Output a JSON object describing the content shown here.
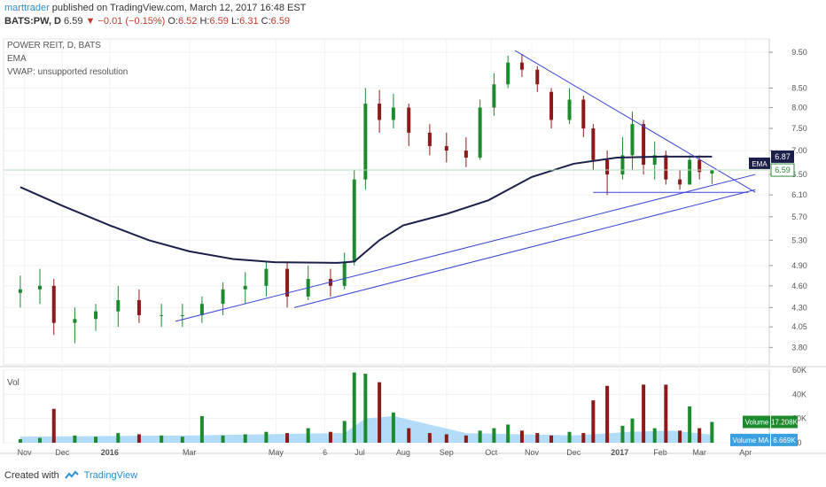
{
  "header": {
    "author": "marttrader",
    "published_text": " published on TradingView.com, March 12, 2017 16:48 EST",
    "symbol": "BATS:PW, D",
    "last": "6.59",
    "change": "−0.01 (−0.15%)",
    "open_label": "O:",
    "open": "6.52",
    "high_label": "H:",
    "high": "6.59",
    "low_label": "L:",
    "low": "6.31",
    "close_label": "C:",
    "close": "6.59"
  },
  "chart_labels": {
    "instrument": "POWER REIT, D, BATS",
    "ema": "EMA",
    "vwap": "VWAP: unsupported resolution",
    "vol": "Vol"
  },
  "price_badges": {
    "ema_value": "6.87",
    "ema_tag": "EMA",
    "last_price": "6.59"
  },
  "volume_badges": {
    "volume_tag": "Volume",
    "volume_value": "17.208K",
    "ma_tag": "Volume MA",
    "ma_value": "6.669K"
  },
  "footer": {
    "created_with": "Created with",
    "brand": "TradingView"
  },
  "colors": {
    "up": "#1e8a2e",
    "down": "#8b1a1a",
    "ema": "#1c1f4a",
    "trendline": "#3a44d6",
    "volume_ma": "#9fd3f5",
    "accent": "#2a8fd3"
  },
  "chart_data": {
    "type": "candlestick",
    "title": "POWER REIT, D, BATS",
    "y_axis_scale": "log",
    "ylim": [
      3.6,
      9.9
    ],
    "price_ticks": [
      "9.50",
      "8.50",
      "8.00",
      "7.50",
      "7.00",
      "6.50",
      "6.10",
      "5.70",
      "5.30",
      "4.90",
      "4.60",
      "4.30",
      "4.05",
      "3.80"
    ],
    "volume_ticks": [
      "60K",
      "40K",
      "20K",
      "0"
    ],
    "x_tick_labels": [
      "Nov",
      "Dec",
      "2016",
      "Mar",
      "May",
      "6",
      "Jul",
      "Aug",
      "Sep",
      "Oct",
      "Nov",
      "Dec",
      "2017",
      "Feb",
      "Mar",
      "Apr"
    ],
    "grid": true,
    "ema_path": [
      {
        "date": "2015-11-01",
        "value": 6.25
      },
      {
        "date": "2015-12-01",
        "value": 5.9
      },
      {
        "date": "2016-01-04",
        "value": 5.55
      },
      {
        "date": "2016-02-01",
        "value": 5.3
      },
      {
        "date": "2016-03-01",
        "value": 5.12
      },
      {
        "date": "2016-04-01",
        "value": 5.0
      },
      {
        "date": "2016-05-01",
        "value": 4.95
      },
      {
        "date": "2016-06-15",
        "value": 4.94
      },
      {
        "date": "2016-06-27",
        "value": 4.96
      },
      {
        "date": "2016-07-15",
        "value": 5.3
      },
      {
        "date": "2016-08-01",
        "value": 5.55
      },
      {
        "date": "2016-09-01",
        "value": 5.75
      },
      {
        "date": "2016-10-01",
        "value": 6.0
      },
      {
        "date": "2016-11-01",
        "value": 6.45
      },
      {
        "date": "2016-12-01",
        "value": 6.72
      },
      {
        "date": "2017-01-01",
        "value": 6.85
      },
      {
        "date": "2017-02-01",
        "value": 6.87
      },
      {
        "date": "2017-03-10",
        "value": 6.87
      }
    ],
    "trendlines": [
      {
        "from": {
          "date": "2016-02-20",
          "price": 4.12
        },
        "to": {
          "date": "2017-04-10",
          "price": 6.5
        }
      },
      {
        "from": {
          "date": "2016-05-15",
          "price": 4.3
        },
        "to": {
          "date": "2017-04-10",
          "price": 6.2
        }
      },
      {
        "from": {
          "date": "2016-10-20",
          "price": 9.55
        },
        "to": {
          "date": "2017-04-10",
          "price": 6.15
        }
      },
      {
        "from": {
          "date": "2016-12-15",
          "price": 6.15
        },
        "to": {
          "date": "2017-04-05",
          "price": 6.15
        }
      }
    ],
    "candles": [
      {
        "date": "2015-11-01",
        "open": 4.5,
        "high": 4.75,
        "low": 4.3,
        "close": 4.55
      },
      {
        "date": "2015-11-15",
        "open": 4.55,
        "high": 4.85,
        "low": 4.35,
        "close": 4.6
      },
      {
        "date": "2015-11-25",
        "open": 4.6,
        "high": 4.7,
        "low": 3.95,
        "close": 4.1
      },
      {
        "date": "2015-12-10",
        "open": 4.1,
        "high": 4.3,
        "low": 3.85,
        "close": 4.15
      },
      {
        "date": "2015-12-25",
        "open": 4.15,
        "high": 4.35,
        "low": 4.0,
        "close": 4.25
      },
      {
        "date": "2016-01-10",
        "open": 4.25,
        "high": 4.6,
        "low": 4.05,
        "close": 4.4
      },
      {
        "date": "2016-01-25",
        "open": 4.4,
        "high": 4.55,
        "low": 4.1,
        "close": 4.2
      },
      {
        "date": "2016-02-10",
        "open": 4.2,
        "high": 4.35,
        "low": 4.05,
        "close": 4.2
      },
      {
        "date": "2016-02-25",
        "open": 4.2,
        "high": 4.35,
        "low": 4.05,
        "close": 4.2
      },
      {
        "date": "2016-03-10",
        "open": 4.2,
        "high": 4.45,
        "low": 4.1,
        "close": 4.35
      },
      {
        "date": "2016-03-25",
        "open": 4.35,
        "high": 4.65,
        "low": 4.2,
        "close": 4.55
      },
      {
        "date": "2016-04-10",
        "open": 4.55,
        "high": 4.8,
        "low": 4.35,
        "close": 4.6
      },
      {
        "date": "2016-04-25",
        "open": 4.6,
        "high": 4.95,
        "low": 4.45,
        "close": 4.85
      },
      {
        "date": "2016-05-10",
        "open": 4.85,
        "high": 4.95,
        "low": 4.3,
        "close": 4.45
      },
      {
        "date": "2016-05-25",
        "open": 4.45,
        "high": 4.9,
        "low": 4.4,
        "close": 4.7
      },
      {
        "date": "2016-06-10",
        "open": 4.7,
        "high": 4.85,
        "low": 4.45,
        "close": 4.6
      },
      {
        "date": "2016-06-20",
        "open": 4.6,
        "high": 5.1,
        "low": 4.55,
        "close": 4.95
      },
      {
        "date": "2016-06-27",
        "open": 4.95,
        "high": 6.6,
        "low": 4.9,
        "close": 6.4
      },
      {
        "date": "2016-07-05",
        "open": 6.4,
        "high": 8.5,
        "low": 6.2,
        "close": 8.1
      },
      {
        "date": "2016-07-15",
        "open": 8.1,
        "high": 8.45,
        "low": 7.4,
        "close": 7.7
      },
      {
        "date": "2016-07-25",
        "open": 7.7,
        "high": 8.35,
        "low": 7.5,
        "close": 8.0
      },
      {
        "date": "2016-08-05",
        "open": 8.0,
        "high": 8.1,
        "low": 7.1,
        "close": 7.4
      },
      {
        "date": "2016-08-20",
        "open": 7.4,
        "high": 7.6,
        "low": 6.9,
        "close": 7.1
      },
      {
        "date": "2016-09-01",
        "open": 7.1,
        "high": 7.4,
        "low": 6.75,
        "close": 7.0
      },
      {
        "date": "2016-09-15",
        "open": 7.0,
        "high": 7.3,
        "low": 6.65,
        "close": 6.85
      },
      {
        "date": "2016-09-25",
        "open": 6.85,
        "high": 8.2,
        "low": 6.8,
        "close": 8.0
      },
      {
        "date": "2016-10-05",
        "open": 8.0,
        "high": 8.9,
        "low": 7.8,
        "close": 8.6
      },
      {
        "date": "2016-10-15",
        "open": 8.6,
        "high": 9.4,
        "low": 8.5,
        "close": 9.2
      },
      {
        "date": "2016-10-25",
        "open": 9.2,
        "high": 9.45,
        "low": 8.8,
        "close": 9.0
      },
      {
        "date": "2016-11-05",
        "open": 9.0,
        "high": 9.1,
        "low": 8.4,
        "close": 8.6
      },
      {
        "date": "2016-11-15",
        "open": 8.4,
        "high": 8.5,
        "low": 7.5,
        "close": 7.7
      },
      {
        "date": "2016-11-28",
        "open": 7.7,
        "high": 8.5,
        "low": 7.6,
        "close": 8.2
      },
      {
        "date": "2016-12-08",
        "open": 8.2,
        "high": 8.3,
        "low": 7.3,
        "close": 7.5
      },
      {
        "date": "2016-12-15",
        "open": 7.5,
        "high": 7.6,
        "low": 6.6,
        "close": 6.8
      },
      {
        "date": "2016-12-25",
        "open": 6.8,
        "high": 7.0,
        "low": 6.1,
        "close": 6.5
      },
      {
        "date": "2017-01-05",
        "open": 6.5,
        "high": 7.3,
        "low": 6.4,
        "close": 6.9
      },
      {
        "date": "2017-01-12",
        "open": 6.9,
        "high": 7.9,
        "low": 6.6,
        "close": 7.6
      },
      {
        "date": "2017-01-20",
        "open": 7.6,
        "high": 7.7,
        "low": 6.5,
        "close": 6.7
      },
      {
        "date": "2017-01-28",
        "open": 6.7,
        "high": 7.2,
        "low": 6.4,
        "close": 6.9
      },
      {
        "date": "2017-02-05",
        "open": 6.9,
        "high": 7.0,
        "low": 6.3,
        "close": 6.4
      },
      {
        "date": "2017-02-15",
        "open": 6.4,
        "high": 6.6,
        "low": 6.2,
        "close": 6.3
      },
      {
        "date": "2017-02-22",
        "open": 6.3,
        "high": 6.9,
        "low": 6.3,
        "close": 6.8
      },
      {
        "date": "2017-03-01",
        "open": 6.8,
        "high": 6.9,
        "low": 6.4,
        "close": 6.55
      },
      {
        "date": "2017-03-10",
        "open": 6.52,
        "high": 6.59,
        "low": 6.31,
        "close": 6.59
      }
    ],
    "volume": [
      {
        "date": "2015-11-01",
        "value": 3
      },
      {
        "date": "2015-11-15",
        "value": 4
      },
      {
        "date": "2015-11-25",
        "value": 28
      },
      {
        "date": "2015-12-10",
        "value": 6
      },
      {
        "date": "2015-12-25",
        "value": 5
      },
      {
        "date": "2016-01-10",
        "value": 8
      },
      {
        "date": "2016-01-25",
        "value": 7
      },
      {
        "date": "2016-02-10",
        "value": 6
      },
      {
        "date": "2016-02-25",
        "value": 5
      },
      {
        "date": "2016-03-10",
        "value": 22
      },
      {
        "date": "2016-03-25",
        "value": 6
      },
      {
        "date": "2016-04-10",
        "value": 7
      },
      {
        "date": "2016-04-25",
        "value": 9
      },
      {
        "date": "2016-05-10",
        "value": 8
      },
      {
        "date": "2016-05-25",
        "value": 12
      },
      {
        "date": "2016-06-10",
        "value": 9
      },
      {
        "date": "2016-06-20",
        "value": 18
      },
      {
        "date": "2016-06-27",
        "value": 58
      },
      {
        "date": "2016-07-05",
        "value": 57
      },
      {
        "date": "2016-07-15",
        "value": 50
      },
      {
        "date": "2016-07-25",
        "value": 25
      },
      {
        "date": "2016-08-05",
        "value": 12
      },
      {
        "date": "2016-08-20",
        "value": 8
      },
      {
        "date": "2016-09-01",
        "value": 7
      },
      {
        "date": "2016-09-15",
        "value": 6
      },
      {
        "date": "2016-09-25",
        "value": 10
      },
      {
        "date": "2016-10-05",
        "value": 12
      },
      {
        "date": "2016-10-15",
        "value": 15
      },
      {
        "date": "2016-10-25",
        "value": 10
      },
      {
        "date": "2016-11-05",
        "value": 8
      },
      {
        "date": "2016-11-15",
        "value": 6
      },
      {
        "date": "2016-11-28",
        "value": 9
      },
      {
        "date": "2016-12-08",
        "value": 8
      },
      {
        "date": "2016-12-15",
        "value": 35
      },
      {
        "date": "2016-12-25",
        "value": 47
      },
      {
        "date": "2017-01-05",
        "value": 14
      },
      {
        "date": "2017-01-12",
        "value": 20
      },
      {
        "date": "2017-01-20",
        "value": 48
      },
      {
        "date": "2017-01-28",
        "value": 12
      },
      {
        "date": "2017-02-05",
        "value": 48
      },
      {
        "date": "2017-02-15",
        "value": 10
      },
      {
        "date": "2017-02-22",
        "value": 30
      },
      {
        "date": "2017-03-01",
        "value": 12
      },
      {
        "date": "2017-03-10",
        "value": 17.2
      }
    ],
    "volume_ma": [
      {
        "date": "2015-11-01",
        "value": 5
      },
      {
        "date": "2016-03-01",
        "value": 6
      },
      {
        "date": "2016-06-20",
        "value": 8
      },
      {
        "date": "2016-07-05",
        "value": 20
      },
      {
        "date": "2016-07-25",
        "value": 22
      },
      {
        "date": "2016-08-20",
        "value": 15
      },
      {
        "date": "2016-09-15",
        "value": 8
      },
      {
        "date": "2016-12-01",
        "value": 6
      },
      {
        "date": "2017-01-10",
        "value": 9
      },
      {
        "date": "2017-02-10",
        "value": 10
      },
      {
        "date": "2017-03-10",
        "value": 6.669
      }
    ],
    "volume_ylim": [
      0,
      60
    ]
  }
}
